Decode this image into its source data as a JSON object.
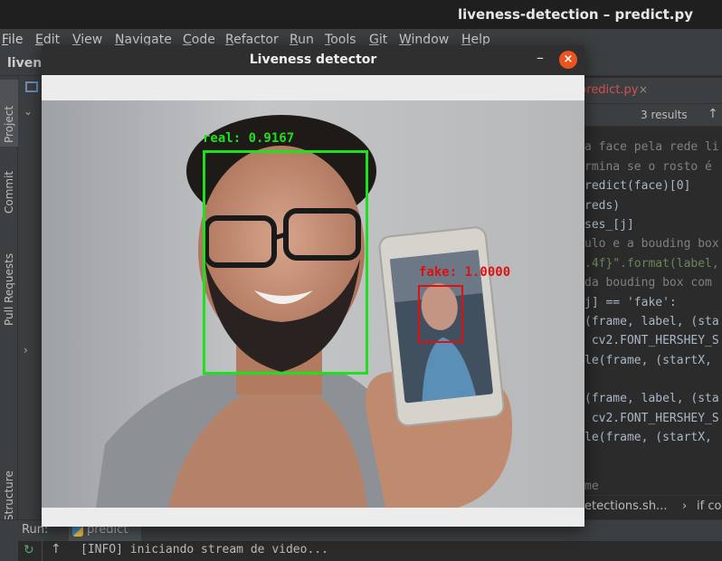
{
  "ide": {
    "window_title": "liveness-detection – predict.py",
    "project_name": "livene",
    "menu": [
      "File",
      "Edit",
      "View",
      "Navigate",
      "Code",
      "Refactor",
      "Run",
      "Tools",
      "Git",
      "Window",
      "Help"
    ],
    "side_tabs": [
      "Project",
      "Commit",
      "Pull Requests",
      "Structure"
    ],
    "editor_tab": "predict.py",
    "editor_tab_close": "×",
    "find_results": "3 results",
    "code_lines": [
      "a face pela rede li",
      "rmina se o rosto é",
      "redict(face)[0]",
      "reds)",
      "ses_[j]",
      "ulo e a bouding box",
      ".4f}\".format(label,",
      "da bouding box com",
      "j] == 'fake':",
      "(frame, label, (sta",
      " cv2.FONT_HERSHEY_S",
      "le(frame, (startX,",
      "(frame, label, (sta",
      " cv2.FONT_HERSHEY_S",
      "le(frame, (startX,",
      "me"
    ],
    "breadcrumb": [
      "etections.sh...",
      "›",
      "if co"
    ],
    "run_label": "Run:",
    "run_tab": "predict",
    "console_line": "[INFO] iniciando stream de video..."
  },
  "dialog": {
    "title": "Liveness detector",
    "minimize_symbol": "–",
    "close_symbol": "×",
    "detections": [
      {
        "label": "real: 0.9167",
        "color": "#1fe01f"
      },
      {
        "label": "fake: 1.0000",
        "color": "#e01010"
      }
    ]
  }
}
